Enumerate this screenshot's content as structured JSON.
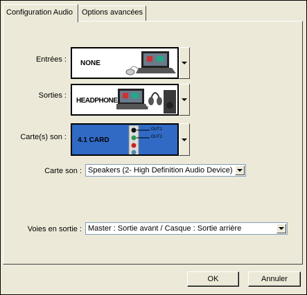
{
  "tabs": [
    {
      "label": "Configuration Audio",
      "active": true
    },
    {
      "label": "Options avancées",
      "active": false
    }
  ],
  "inputs": {
    "label": "Entrées :",
    "value": "NONE",
    "icon": "laptop-mouse-icon"
  },
  "outputs": {
    "label": "Sorties :",
    "value": "HEADPHONES",
    "icon": "laptop-headphones-speaker-icon"
  },
  "cards": {
    "label": "Carte(s) son :",
    "value": "4.1 CARD",
    "out1": "OUT1",
    "out2": "OUT2",
    "icon": "soundcard-jacks-icon",
    "color": "#316ac5"
  },
  "sound_card": {
    "label": "Carte son :",
    "value": "Speakers (2- High Definition Audio Device)"
  },
  "output_channels": {
    "label": "Voies en sortie :",
    "value": "Master : Sortie avant / Casque : Sortie arrière"
  },
  "buttons": {
    "ok": "OK",
    "cancel": "Annuler"
  }
}
